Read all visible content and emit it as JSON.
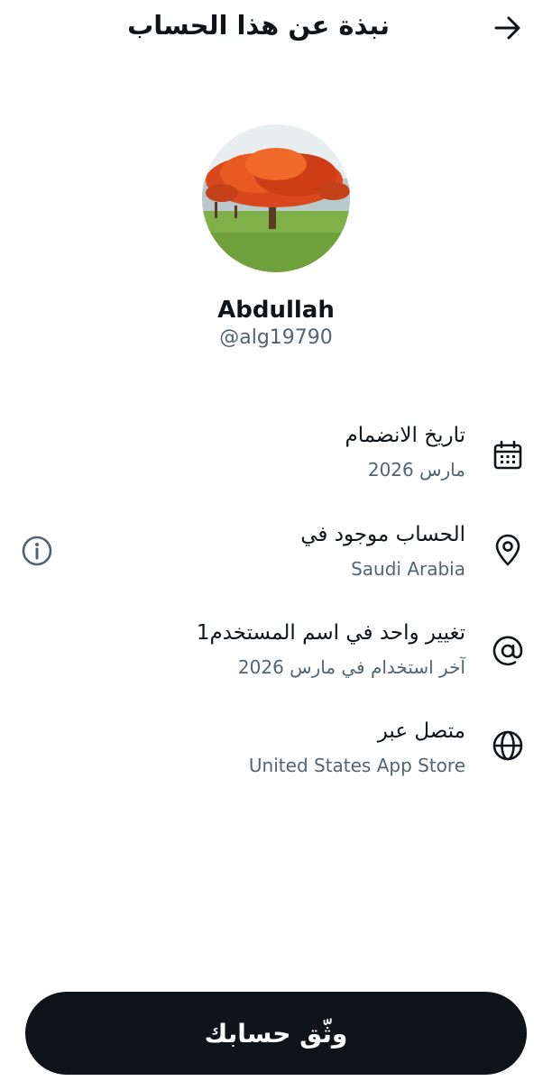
{
  "header": {
    "title": "نبذة عن هذا الحساب",
    "back_icon": "arrow-right-icon"
  },
  "profile": {
    "avatar_icon": "profile-photo-flame-tree",
    "display_name": "Abdullah",
    "handle": "@alg19790"
  },
  "details": [
    {
      "icon": "calendar-icon",
      "label": "تاريخ الانضمام",
      "value": "مارس 2026"
    },
    {
      "icon": "location-pin-icon",
      "label": "الحساب موجود في",
      "value": "Saudi Arabia",
      "action_icon": "info-icon"
    },
    {
      "icon": "at-sign-icon",
      "label": "تغيير واحد في اسم المستخدم1",
      "value": "آخر استخدام في مارس 2026"
    },
    {
      "icon": "globe-icon",
      "label": "متصل عبر",
      "value": "United States App Store"
    }
  ],
  "footer": {
    "verify_label": "وثّق حسابك"
  },
  "colors": {
    "primary_text": "#0f1419",
    "secondary_text": "#536471",
    "button_bg": "#0f1419",
    "button_text": "#ffffff"
  }
}
